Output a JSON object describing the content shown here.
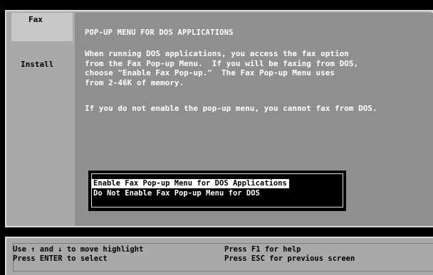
{
  "nav": {
    "items": [
      {
        "label": "Fax",
        "selected": true
      },
      {
        "label": "Install",
        "selected": false
      }
    ]
  },
  "panel": {
    "title": "POP-UP MENU FOR DOS APPLICATIONS",
    "paragraph1": "When running DOS applications, you access the fax option\nfrom the Fax Pop-up Menu.  If you will be faxing from DOS,\nchoose \"Enable Fax Pop-up.\"  The Fax Pop-up Menu uses\nfrom 2-46K of memory.",
    "paragraph2": "If you do not enable the pop-up menu, you cannot fax from DOS."
  },
  "options": [
    {
      "label": "Enable Fax Pop-up Menu for DOS Applications",
      "highlighted": true
    },
    {
      "label": "Do Not Enable Fax Pop-up Menu for DOS",
      "highlighted": false
    }
  ],
  "footer": {
    "nav_hint": "Use ↑ and ↓ to move highlight",
    "enter_hint": "Press ENTER to select",
    "help_hint": "Press F1 for help",
    "back_hint": "Press ESC for previous screen"
  },
  "colors": {
    "background": "#000000",
    "frame": "#a9a9a9",
    "panel": "#8f8f8f",
    "highlight": "#ffffff",
    "text_light": "#ffffff",
    "text_dark": "#000000"
  }
}
